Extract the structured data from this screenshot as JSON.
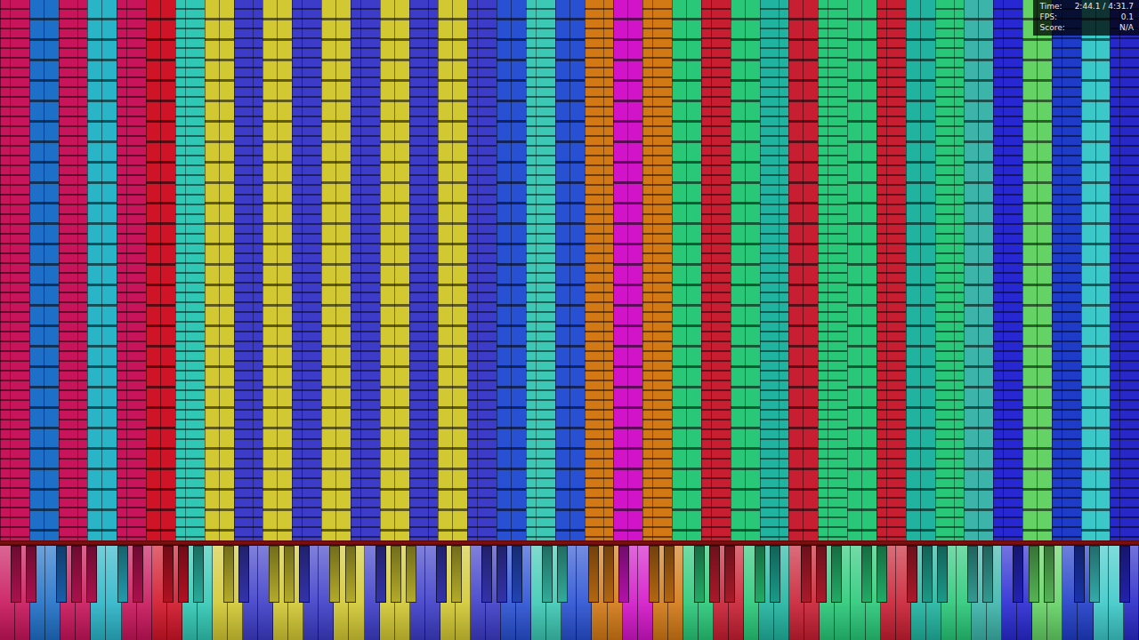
{
  "hud": [
    {
      "label": "Time:",
      "value": "2:44.1 / 4:31.7"
    },
    {
      "label": "FPS:",
      "value": "0.1"
    },
    {
      "label": "Score:",
      "value": "N/A"
    }
  ],
  "lanes": [
    {
      "color": "#c8145a"
    },
    {
      "color": "#1e6fc8"
    },
    {
      "color": "#c8145a"
    },
    {
      "color": "#2ab4c8"
    },
    {
      "color": "#c8145a"
    },
    {
      "color": "#d01428"
    },
    {
      "color": "#30c8b4"
    },
    {
      "color": "#d2c832"
    },
    {
      "color": "#3c3cc8"
    },
    {
      "color": "#d2c832"
    },
    {
      "color": "#3c3cc8"
    },
    {
      "color": "#d2c832"
    },
    {
      "color": "#3c3cc8"
    },
    {
      "color": "#d2c832"
    },
    {
      "color": "#3c3cc8"
    },
    {
      "color": "#d2c832"
    },
    {
      "color": "#3c3cc8"
    },
    {
      "color": "#2850d2"
    },
    {
      "color": "#3cc8b4"
    },
    {
      "color": "#2850d2"
    },
    {
      "color": "#d27814"
    },
    {
      "color": "#d214c8"
    },
    {
      "color": "#d27814"
    },
    {
      "color": "#28c878"
    },
    {
      "color": "#c81e32"
    },
    {
      "color": "#28c878"
    },
    {
      "color": "#20b4a0"
    },
    {
      "color": "#c81e32"
    },
    {
      "color": "#28c878"
    },
    {
      "color": "#28c878"
    },
    {
      "color": "#c81e32"
    },
    {
      "color": "#20b4a0"
    },
    {
      "color": "#28c878"
    },
    {
      "color": "#3cb4aa"
    },
    {
      "color": "#2828d2"
    },
    {
      "color": "#64d264"
    },
    {
      "color": "#1e3cc8"
    },
    {
      "color": "#3cc8c8"
    },
    {
      "color": "#2828c8"
    }
  ]
}
